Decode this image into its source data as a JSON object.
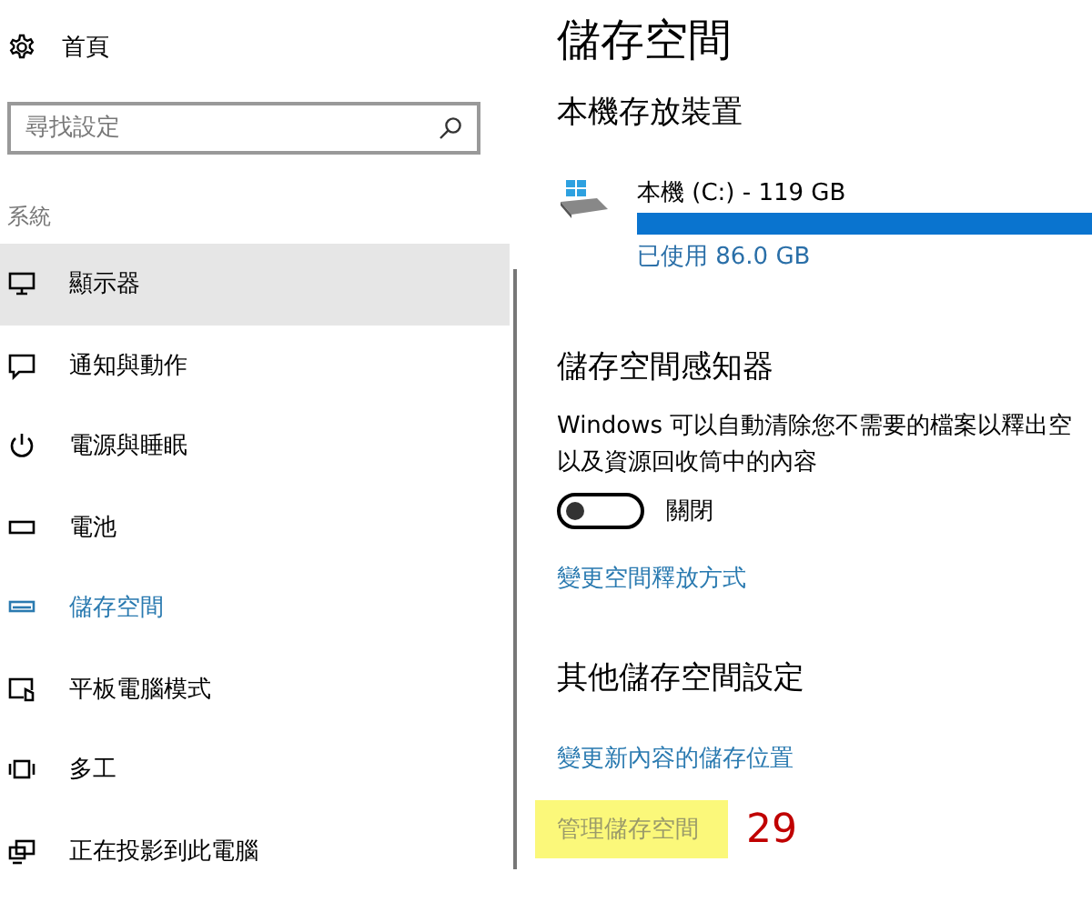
{
  "sidebar": {
    "home": {
      "label": "首頁"
    },
    "search": {
      "placeholder": "尋找設定"
    },
    "section": "系統",
    "items": [
      {
        "label": "顯示器",
        "kind": "monitor",
        "hovered": true,
        "selected": false
      },
      {
        "label": "通知與動作",
        "kind": "message",
        "hovered": false,
        "selected": false
      },
      {
        "label": "電源與睡眠",
        "kind": "power",
        "hovered": false,
        "selected": false
      },
      {
        "label": "電池",
        "kind": "battery",
        "hovered": false,
        "selected": false
      },
      {
        "label": "儲存空間",
        "kind": "drive",
        "hovered": false,
        "selected": true
      },
      {
        "label": "平板電腦模式",
        "kind": "tablet",
        "hovered": false,
        "selected": false
      },
      {
        "label": "多工",
        "kind": "multitask",
        "hovered": false,
        "selected": false
      },
      {
        "label": "正在投影到此電腦",
        "kind": "project",
        "hovered": false,
        "selected": false
      }
    ]
  },
  "main": {
    "title": "儲存空間",
    "local": {
      "heading": "本機存放裝置",
      "drive": {
        "name": "本機 (C:) - 119 GB",
        "level": 1,
        "used": "已使用 86.0 GB"
      }
    },
    "sense": {
      "heading": "儲存空間感知器",
      "description": [
        "Windows 可以自動清除您不需要的檔案以釋出空",
        "以及資源回收筒中的內容"
      ],
      "toggle": {
        "on": false,
        "label": "關閉"
      },
      "link": "變更空間釋放方式"
    },
    "other": {
      "heading": "其他儲存空間設定",
      "links": [
        {
          "label": "變更新內容的儲存位置",
          "highlighted": false
        },
        {
          "label": "管理儲存空間",
          "highlighted": true,
          "annotation": "29"
        }
      ]
    }
  }
}
